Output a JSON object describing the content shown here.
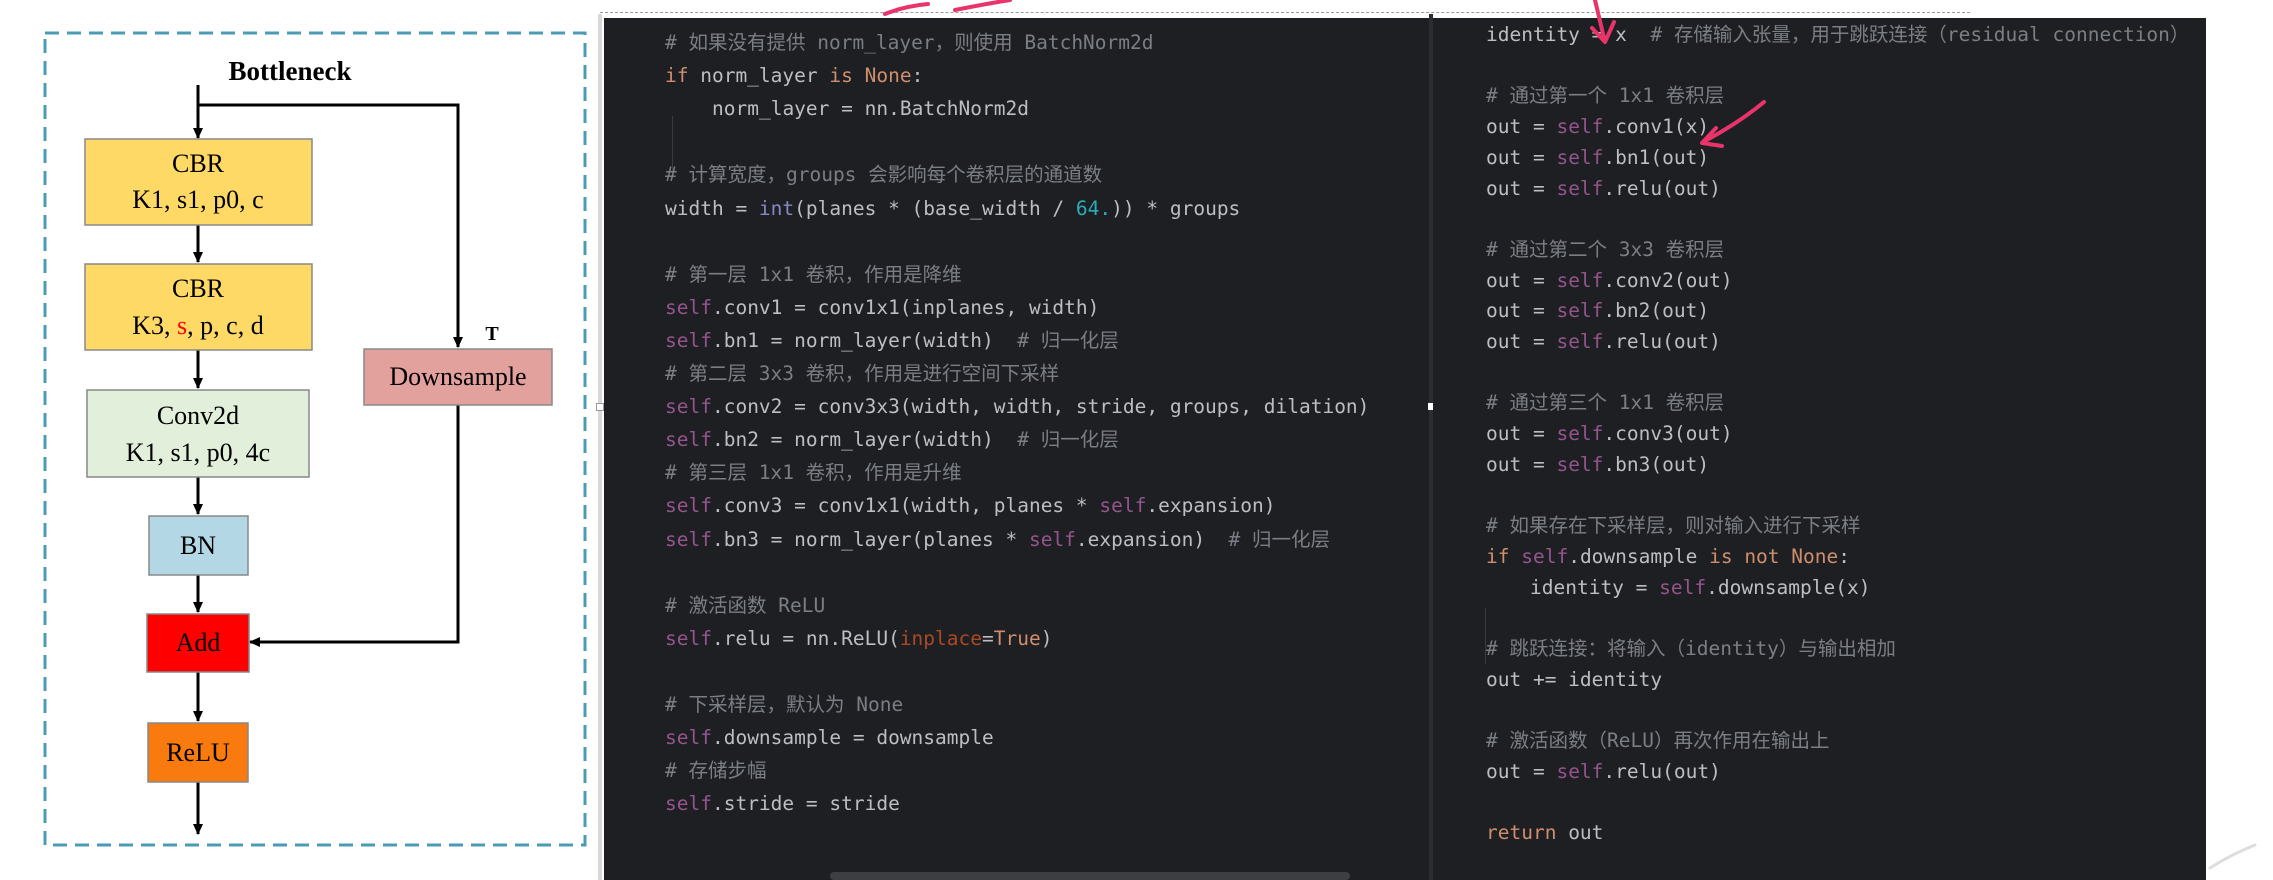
{
  "diagram": {
    "title": "Bottleneck",
    "boxes": [
      {
        "id": "cbr1",
        "line1": "CBR",
        "line2": "K1, s1, p0, c",
        "fill": "#ffd966"
      },
      {
        "id": "cbr2",
        "line1": "CBR",
        "line2_parts": [
          "K3, ",
          "s",
          ", p, c, d"
        ],
        "fill": "#ffd966",
        "highlight": "#ff0000"
      },
      {
        "id": "conv2d",
        "line1": "Conv2d",
        "line2": "K1, s1, p0, 4c",
        "fill": "#e2efda"
      },
      {
        "id": "bn",
        "line1": "BN",
        "fill": "#b4d7e6"
      },
      {
        "id": "add",
        "line1": "Add",
        "fill": "#ff0000"
      },
      {
        "id": "relu",
        "line1": "ReLU",
        "fill": "#f97a0e"
      },
      {
        "id": "downsample",
        "line1": "Downsample",
        "fill": "#e3a19d"
      }
    ],
    "branch_label": "T",
    "border_color": "#4c9bb5"
  },
  "code_left": [
    {
      "indent": 0,
      "tokens": [
        [
          "cm",
          "# 如果没有提供 norm_layer，则使用 BatchNorm2d"
        ]
      ]
    },
    {
      "indent": 0,
      "tokens": [
        [
          "kw",
          "if"
        ],
        [
          "df",
          " norm_layer "
        ],
        [
          "kw",
          "is"
        ],
        [
          "df",
          " "
        ],
        [
          "kw",
          "None"
        ],
        [
          "df",
          ":"
        ]
      ]
    },
    {
      "indent": 1,
      "tokens": [
        [
          "df",
          "norm_layer = nn.BatchNorm2d"
        ]
      ]
    },
    {
      "indent": 0,
      "tokens": []
    },
    {
      "indent": 0,
      "tokens": [
        [
          "cm",
          "# 计算宽度，groups 会影响每个卷积层的通道数"
        ]
      ]
    },
    {
      "indent": 0,
      "tokens": [
        [
          "df",
          "width = "
        ],
        [
          "bi",
          "int"
        ],
        [
          "df",
          "(planes * (base_width / "
        ],
        [
          "nm",
          "64."
        ],
        [
          "df",
          ")) * groups"
        ]
      ]
    },
    {
      "indent": 0,
      "tokens": []
    },
    {
      "indent": 0,
      "tokens": [
        [
          "cm",
          "# 第一层 1x1 卷积，作用是降维"
        ]
      ]
    },
    {
      "indent": 0,
      "tokens": [
        [
          "sf",
          "self"
        ],
        [
          "df",
          ".conv1 = conv1x1(inplanes, width)"
        ]
      ]
    },
    {
      "indent": 0,
      "tokens": [
        [
          "sf",
          "self"
        ],
        [
          "df",
          ".bn1 = norm_layer(width)"
        ],
        [
          "cm",
          "  # 归一化层"
        ]
      ]
    },
    {
      "indent": 0,
      "tokens": [
        [
          "cm",
          "# 第二层 3x3 卷积，作用是进行空间下采样"
        ]
      ]
    },
    {
      "indent": 0,
      "tokens": [
        [
          "sf",
          "self"
        ],
        [
          "df",
          ".conv2 = conv3x3(width, width, stride, groups, dilation)"
        ]
      ]
    },
    {
      "indent": 0,
      "tokens": [
        [
          "sf",
          "self"
        ],
        [
          "df",
          ".bn2 = norm_layer(width)"
        ],
        [
          "cm",
          "  # 归一化层"
        ]
      ]
    },
    {
      "indent": 0,
      "tokens": [
        [
          "cm",
          "# 第三层 1x1 卷积，作用是升维"
        ]
      ]
    },
    {
      "indent": 0,
      "tokens": [
        [
          "sf",
          "self"
        ],
        [
          "df",
          ".conv3 = conv1x1(width, planes * "
        ],
        [
          "sf",
          "self"
        ],
        [
          "df",
          ".expansion)"
        ]
      ]
    },
    {
      "indent": 0,
      "tokens": [
        [
          "sf",
          "self"
        ],
        [
          "df",
          ".bn3 = norm_layer(planes * "
        ],
        [
          "sf",
          "self"
        ],
        [
          "df",
          ".expansion)"
        ],
        [
          "cm",
          "  # 归一化层"
        ]
      ]
    },
    {
      "indent": 0,
      "tokens": []
    },
    {
      "indent": 0,
      "tokens": [
        [
          "cm",
          "# 激活函数 ReLU"
        ]
      ]
    },
    {
      "indent": 0,
      "tokens": [
        [
          "sf",
          "self"
        ],
        [
          "df",
          ".relu = nn.ReLU("
        ],
        [
          "pa",
          "inplace"
        ],
        [
          "df",
          "="
        ],
        [
          "kw",
          "True"
        ],
        [
          "df",
          ")"
        ]
      ]
    },
    {
      "indent": 0,
      "tokens": []
    },
    {
      "indent": 0,
      "tokens": [
        [
          "cm",
          "# 下采样层，默认为 None"
        ]
      ]
    },
    {
      "indent": 0,
      "tokens": [
        [
          "sf",
          "self"
        ],
        [
          "df",
          ".downsample = downsample"
        ]
      ]
    },
    {
      "indent": 0,
      "tokens": [
        [
          "cm",
          "# 存储步幅"
        ]
      ]
    },
    {
      "indent": 0,
      "tokens": [
        [
          "sf",
          "self"
        ],
        [
          "df",
          ".stride = stride"
        ]
      ]
    }
  ],
  "code_right": [
    {
      "indent": 0,
      "tokens": [
        [
          "df",
          "identity = x"
        ],
        [
          "cm",
          "  # 存储输入张量，用于跳跃连接（residual connection）"
        ]
      ]
    },
    {
      "indent": 0,
      "tokens": []
    },
    {
      "indent": 0,
      "tokens": [
        [
          "cm",
          "# 通过第一个 1x1 卷积层"
        ]
      ]
    },
    {
      "indent": 0,
      "tokens": [
        [
          "df",
          "out = "
        ],
        [
          "sf",
          "self"
        ],
        [
          "df",
          ".conv1(x)"
        ]
      ]
    },
    {
      "indent": 0,
      "tokens": [
        [
          "df",
          "out = "
        ],
        [
          "sf",
          "self"
        ],
        [
          "df",
          ".bn1(out)"
        ]
      ]
    },
    {
      "indent": 0,
      "tokens": [
        [
          "df",
          "out = "
        ],
        [
          "sf",
          "self"
        ],
        [
          "df",
          ".relu(out)"
        ]
      ]
    },
    {
      "indent": 0,
      "tokens": []
    },
    {
      "indent": 0,
      "tokens": [
        [
          "cm",
          "# 通过第二个 3x3 卷积层"
        ]
      ]
    },
    {
      "indent": 0,
      "tokens": [
        [
          "df",
          "out = "
        ],
        [
          "sf",
          "self"
        ],
        [
          "df",
          ".conv2(out)"
        ]
      ]
    },
    {
      "indent": 0,
      "tokens": [
        [
          "df",
          "out = "
        ],
        [
          "sf",
          "self"
        ],
        [
          "df",
          ".bn2(out)"
        ]
      ]
    },
    {
      "indent": 0,
      "tokens": [
        [
          "df",
          "out = "
        ],
        [
          "sf",
          "self"
        ],
        [
          "df",
          ".relu(out)"
        ]
      ]
    },
    {
      "indent": 0,
      "tokens": []
    },
    {
      "indent": 0,
      "tokens": [
        [
          "cm",
          "# 通过第三个 1x1 卷积层"
        ]
      ]
    },
    {
      "indent": 0,
      "tokens": [
        [
          "df",
          "out = "
        ],
        [
          "sf",
          "self"
        ],
        [
          "df",
          ".conv3(out)"
        ]
      ]
    },
    {
      "indent": 0,
      "tokens": [
        [
          "df",
          "out = "
        ],
        [
          "sf",
          "self"
        ],
        [
          "df",
          ".bn3(out)"
        ]
      ]
    },
    {
      "indent": 0,
      "tokens": []
    },
    {
      "indent": 0,
      "tokens": [
        [
          "cm",
          "# 如果存在下采样层，则对输入进行下采样"
        ]
      ]
    },
    {
      "indent": 0,
      "tokens": [
        [
          "kw",
          "if"
        ],
        [
          "df",
          " "
        ],
        [
          "sf",
          "self"
        ],
        [
          "df",
          ".downsample "
        ],
        [
          "kw",
          "is not"
        ],
        [
          "df",
          " "
        ],
        [
          "kw",
          "None"
        ],
        [
          "df",
          ":"
        ]
      ]
    },
    {
      "indent": 1,
      "tokens": [
        [
          "df",
          "identity = "
        ],
        [
          "sf",
          "self"
        ],
        [
          "df",
          ".downsample(x)"
        ]
      ]
    },
    {
      "indent": 0,
      "tokens": []
    },
    {
      "indent": 0,
      "tokens": [
        [
          "cm",
          "# 跳跃连接：将输入（identity）与输出相加"
        ]
      ]
    },
    {
      "indent": 0,
      "tokens": [
        [
          "df",
          "out += identity"
        ]
      ]
    },
    {
      "indent": 0,
      "tokens": []
    },
    {
      "indent": 0,
      "tokens": [
        [
          "cm",
          "# 激活函数（ReLU）再次作用在输出上"
        ]
      ]
    },
    {
      "indent": 0,
      "tokens": [
        [
          "df",
          "out = "
        ],
        [
          "sf",
          "self"
        ],
        [
          "df",
          ".relu(out)"
        ]
      ]
    },
    {
      "indent": 0,
      "tokens": []
    },
    {
      "indent": 0,
      "tokens": [
        [
          "kw",
          "return"
        ],
        [
          "df",
          " out"
        ]
      ]
    }
  ],
  "annotation_color": "#e8336b"
}
